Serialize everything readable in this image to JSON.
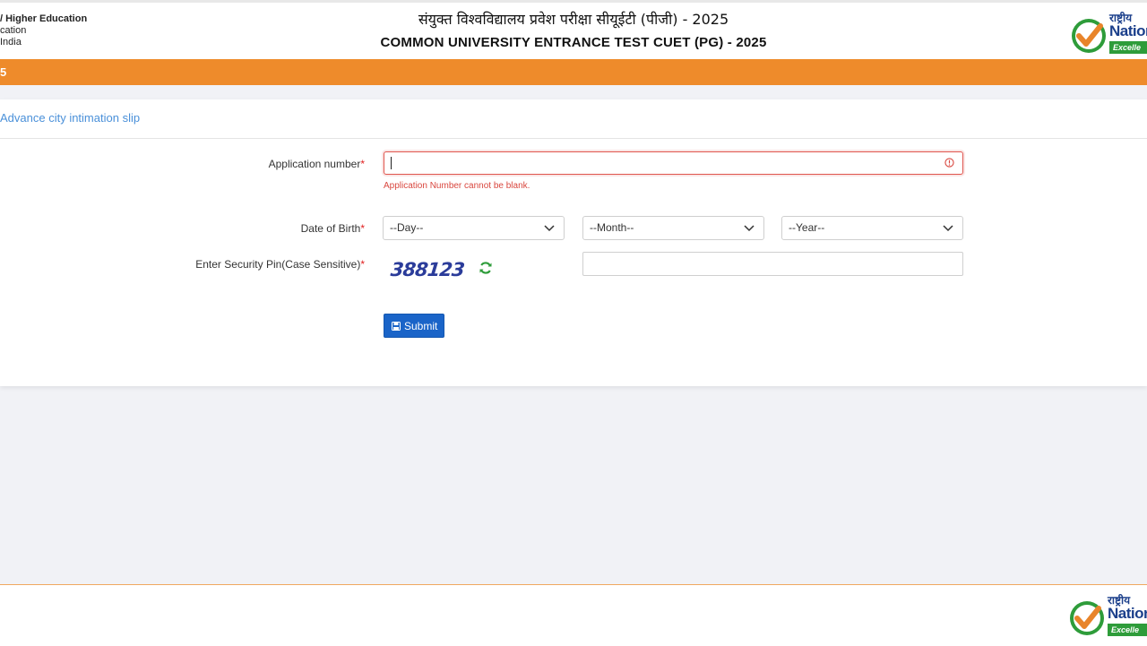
{
  "header": {
    "ministry_line1": "/ Higher Education",
    "ministry_line2": "cation",
    "ministry_line3": "India",
    "title_hindi": "संयुक्त विश्वविद्यालय प्रवेश परीक्षा सीयूईटी (पीजी) - 2025",
    "title_english": "COMMON UNIVERSITY ENTRANCE TEST CUET (PG) - 2025",
    "logo": {
      "text_hindi": "राष्ट्रीय",
      "text_english": "Nation",
      "tagline": "Excelle"
    }
  },
  "orange_bar": {
    "text": "5"
  },
  "card": {
    "heading": "Advance city intimation slip",
    "application_number": {
      "label": "Application number",
      "required_mark": "*",
      "value": "",
      "error": "Application Number cannot be blank."
    },
    "dob": {
      "label": "Date of Birth",
      "required_mark": "*",
      "day": "--Day--",
      "month": "--Month--",
      "year": "--Year--"
    },
    "security_pin": {
      "label": "Enter Security Pin(Case Sensitive)",
      "required_mark": "*",
      "captcha": "388123",
      "value": ""
    },
    "submit_label": "Submit"
  },
  "footer": {
    "logo": {
      "text_hindi": "राष्ट्रीय",
      "text_english": "Nation",
      "tagline": "Excelle"
    }
  },
  "colors": {
    "orange": "#ee8b2b",
    "link_blue": "#4a90d9",
    "button_blue": "#1a64c8",
    "error_red": "#d9473f",
    "logo_green": "#2e9c3a",
    "logo_navy": "#1b3f8b"
  },
  "icons": [
    "alert-circle-icon",
    "chevron-down-icon",
    "refresh-icon",
    "save-icon",
    "checkmark-logo-icon"
  ]
}
